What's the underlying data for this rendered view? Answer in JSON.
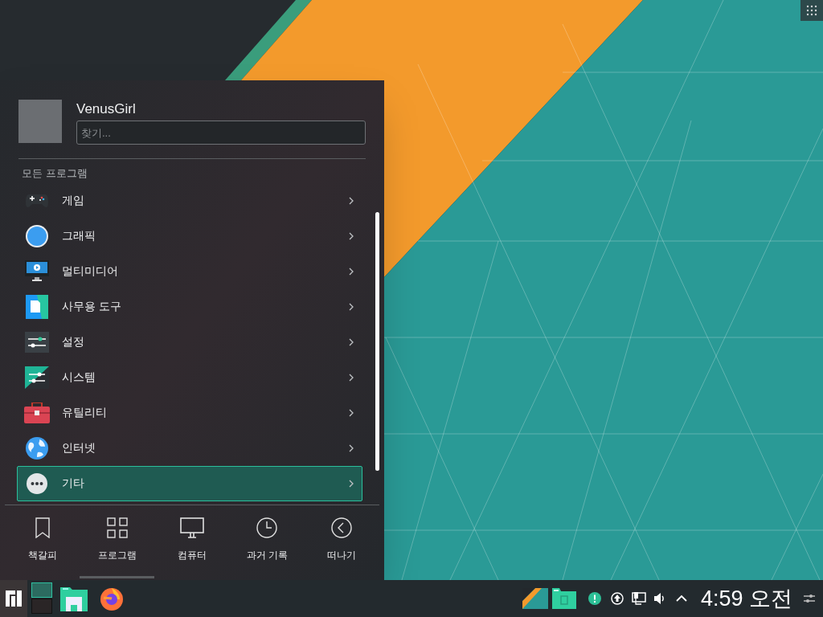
{
  "user": {
    "name": "VenusGirl"
  },
  "search": {
    "placeholder": "찾기..."
  },
  "section_title": "모든 프로그램",
  "categories": [
    {
      "label": "게임",
      "selected": false
    },
    {
      "label": "그래픽",
      "selected": false
    },
    {
      "label": "멀티미디어",
      "selected": false
    },
    {
      "label": "사무용 도구",
      "selected": false
    },
    {
      "label": "설정",
      "selected": false
    },
    {
      "label": "시스템",
      "selected": false
    },
    {
      "label": "유틸리티",
      "selected": false
    },
    {
      "label": "인터넷",
      "selected": false
    },
    {
      "label": "기타",
      "selected": true
    }
  ],
  "tabs": [
    {
      "label": "책갈피",
      "selected": false
    },
    {
      "label": "프로그램",
      "selected": true
    },
    {
      "label": "컴퓨터",
      "selected": false
    },
    {
      "label": "과거 기록",
      "selected": false
    },
    {
      "label": "떠나기",
      "selected": false
    }
  ],
  "taskbar": {
    "clock": "4:59 오전"
  }
}
